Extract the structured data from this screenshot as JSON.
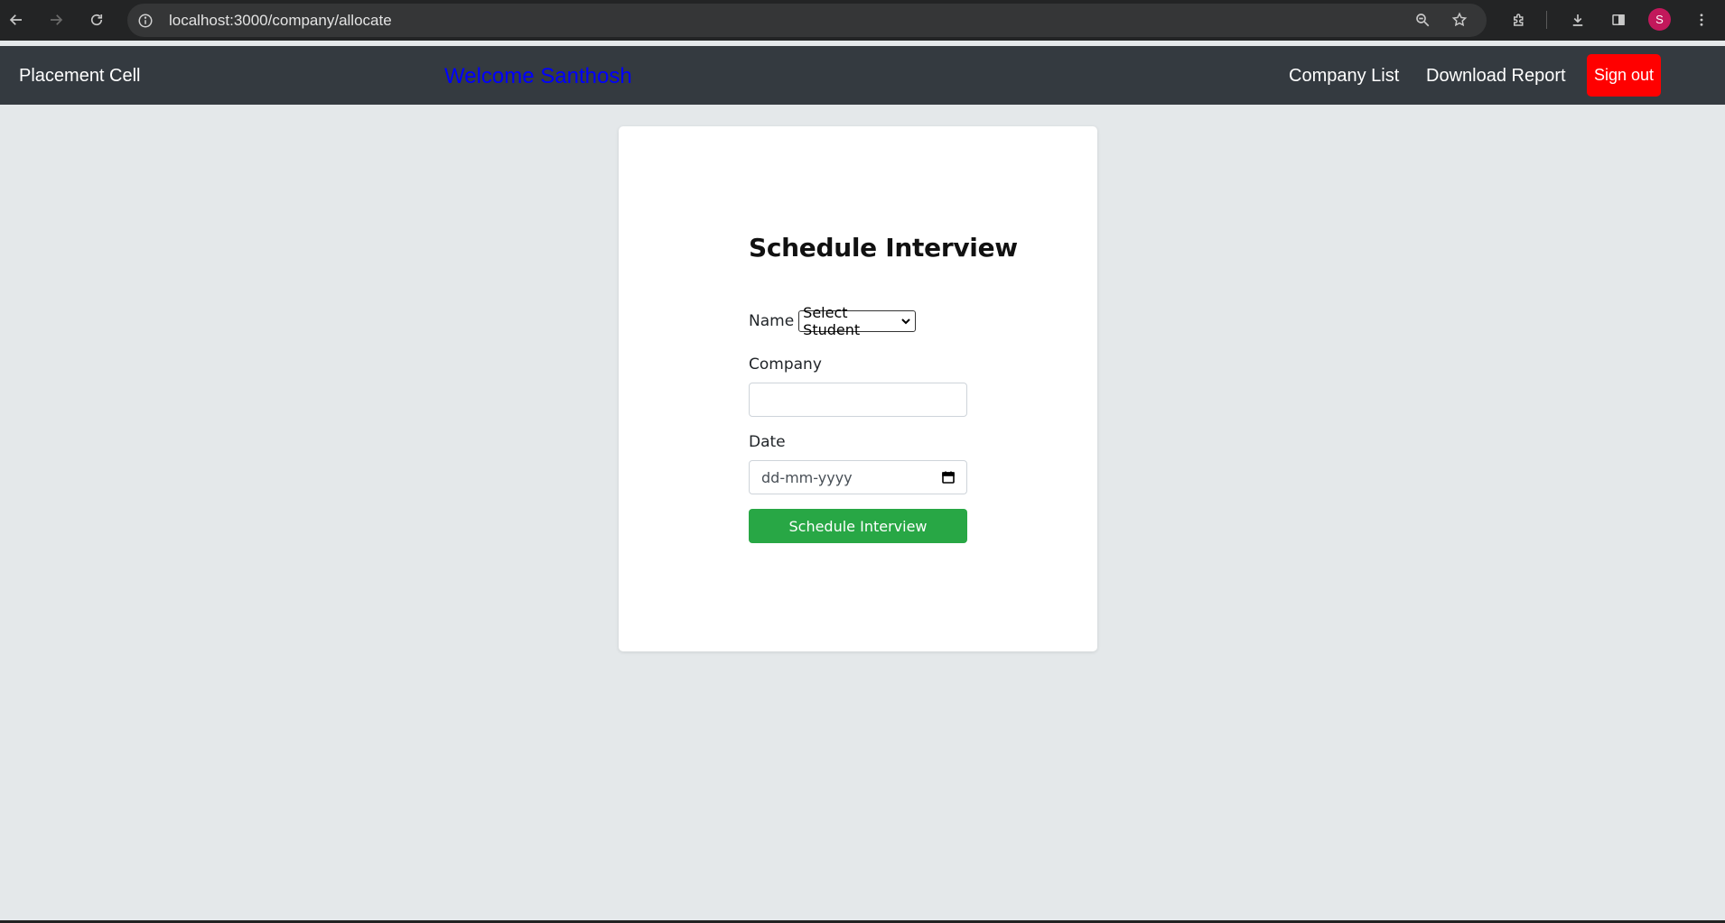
{
  "browser": {
    "url": "localhost:3000/company/allocate",
    "profile_initial": "S",
    "icons": [
      "back-icon",
      "forward-icon",
      "reload-icon",
      "site-info-icon",
      "zoom-icon",
      "bookmark-star-icon",
      "extensions-icon",
      "download-icon",
      "side-panel-icon",
      "menu-icon"
    ]
  },
  "navbar": {
    "brand": "Placement Cell",
    "welcome": "Welcome Santhosh",
    "links": {
      "company_list": "Company List",
      "download_report": "Download Report"
    },
    "signout_label": "Sign out",
    "colors": {
      "background": "#343a40",
      "welcome_text": "#0000ff",
      "signout_bg": "#ff0000"
    }
  },
  "form": {
    "title": "Schedule Interview",
    "name_label": "Name",
    "student_select_value": "Select Student",
    "company_label": "Company",
    "company_value": "",
    "date_label": "Date",
    "date_placeholder": "dd-mm-yyyy",
    "submit_label": "Schedule Interview",
    "colors": {
      "submit_bg": "#28a745",
      "page_bg": "#e4e8ea"
    }
  }
}
